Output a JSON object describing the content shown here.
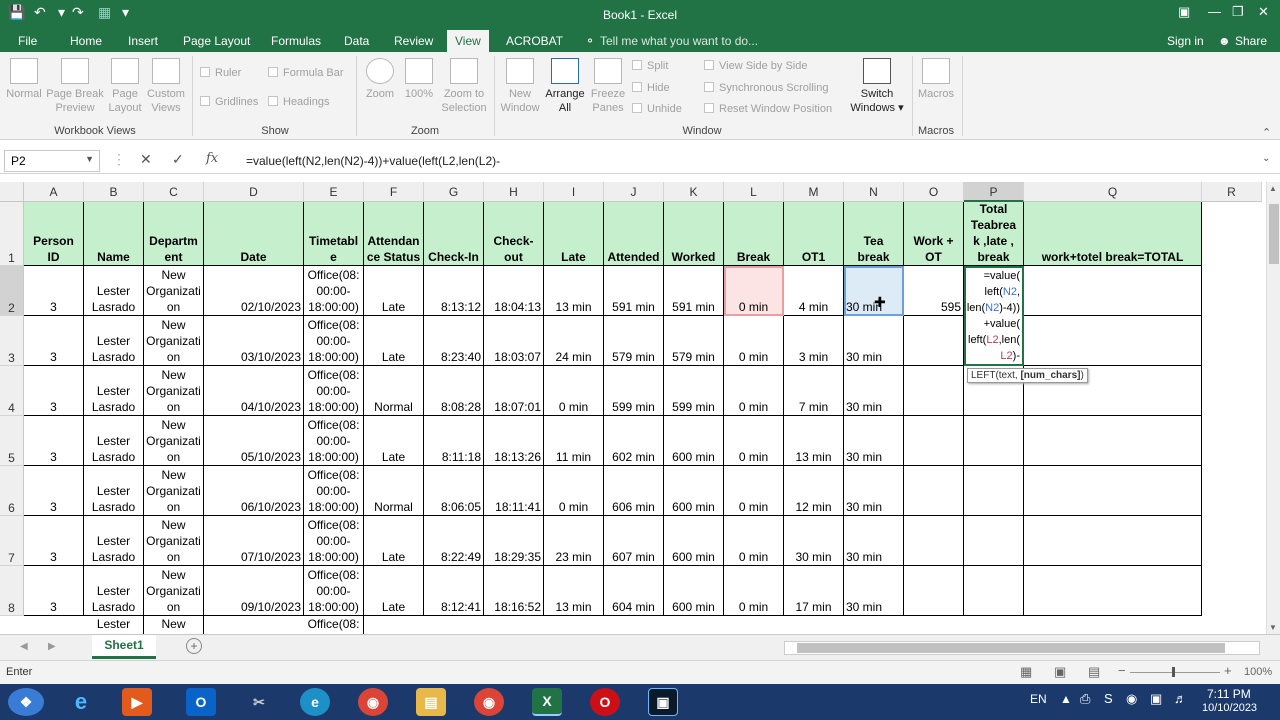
{
  "window": {
    "title": "Book1 - Excel"
  },
  "ribbon_tabs": [
    "File",
    "Home",
    "Insert",
    "Page Layout",
    "Formulas",
    "Data",
    "Review",
    "View",
    "ACROBAT"
  ],
  "active_tab": "View",
  "tell_me": "Tell me what you want to do...",
  "sign_in": "Sign in",
  "share": "Share",
  "ribbon": {
    "workbook_views": [
      "Normal",
      "Page Break Preview",
      "Page Layout",
      "Custom Views"
    ],
    "workbook_views_label": "Workbook Views",
    "show": {
      "ruler": "Ruler",
      "formula_bar": "Formula Bar",
      "gridlines": "Gridlines",
      "headings": "Headings",
      "label": "Show"
    },
    "zoom": {
      "zoom": "Zoom",
      "zoom100": "100%",
      "zoom_sel": "Zoom to Selection",
      "label": "Zoom"
    },
    "window": {
      "new_window": "New Window",
      "arrange_all": "Arrange All",
      "freeze": "Freeze Panes",
      "split": "Split",
      "hide": "Hide",
      "unhide": "Unhide",
      "side_by_side": "View Side by Side",
      "sync": "Synchronous Scrolling",
      "reset": "Reset Window Position",
      "switch": "Switch Windows",
      "label": "Window"
    },
    "macros": {
      "macros": "Macros",
      "label": "Macros"
    }
  },
  "namebox": "P2",
  "formula": "=value(left(N2,len(N2)-4))+value(left(L2,len(L2)-",
  "columns": [
    "A",
    "B",
    "C",
    "D",
    "E",
    "F",
    "G",
    "H",
    "I",
    "J",
    "K",
    "L",
    "M",
    "N",
    "O",
    "P",
    "Q",
    "R"
  ],
  "headers": {
    "A": "Person ID",
    "B": "Name",
    "C": "Department",
    "D": "Date",
    "E": "Timetable",
    "F": "Attendance Status",
    "G": "Check-In",
    "H": "Check-out",
    "I": "Late",
    "J": "Attended",
    "K": "Worked",
    "L": "Break",
    "M": "OT1",
    "N": "Tea break",
    "O": "Work + OT",
    "P": "Total Teabreak ,late , break",
    "Q": "work+totel break=TOTAL"
  },
  "header_wrapped": {
    "C": "Departm\nent",
    "E": "Timetabl\ne",
    "F": "Attendan\nce Status",
    "H": "Check-\nout",
    "P": "Total\nTeabrea\nk ,late ,\nbreak"
  },
  "rows": [
    {
      "num": "2",
      "id": "3",
      "name": "Lester Lasrado",
      "dept": "New Organizati on",
      "date": "02/10/2023",
      "timetable": "Office(08: 00:00- 18:00:00)",
      "status": "Late",
      "checkin": "8:13:12",
      "checkout": "18:04:13",
      "late": "13 min",
      "attended": "591 min",
      "worked": "591 min",
      "break": "0 min",
      "ot1": "4 min",
      "tea": "30 min",
      "workot": "595"
    },
    {
      "num": "3",
      "id": "3",
      "name": "Lester Lasrado",
      "dept": "New Organizati on",
      "date": "03/10/2023",
      "timetable": "Office(08: 00:00- 18:00:00)",
      "status": "Late",
      "checkin": "8:23:40",
      "checkout": "18:03:07",
      "late": "24 min",
      "attended": "579 min",
      "worked": "579 min",
      "break": "0 min",
      "ot1": "3 min",
      "tea": "30 min",
      "workot": ""
    },
    {
      "num": "4",
      "id": "3",
      "name": "Lester Lasrado",
      "dept": "New Organizati on",
      "date": "04/10/2023",
      "timetable": "Office(08: 00:00- 18:00:00)",
      "status": "Normal",
      "checkin": "8:08:28",
      "checkout": "18:07:01",
      "late": "0 min",
      "attended": "599 min",
      "worked": "599 min",
      "break": "0 min",
      "ot1": "7 min",
      "tea": "30 min",
      "workot": ""
    },
    {
      "num": "5",
      "id": "3",
      "name": "Lester Lasrado",
      "dept": "New Organizati on",
      "date": "05/10/2023",
      "timetable": "Office(08: 00:00- 18:00:00)",
      "status": "Late",
      "checkin": "8:11:18",
      "checkout": "18:13:26",
      "late": "11 min",
      "attended": "602 min",
      "worked": "600 min",
      "break": "0 min",
      "ot1": "13 min",
      "tea": "30 min",
      "workot": ""
    },
    {
      "num": "6",
      "id": "3",
      "name": "Lester Lasrado",
      "dept": "New Organizati on",
      "date": "06/10/2023",
      "timetable": "Office(08: 00:00- 18:00:00)",
      "status": "Normal",
      "checkin": "8:06:05",
      "checkout": "18:11:41",
      "late": "0 min",
      "attended": "606 min",
      "worked": "600 min",
      "break": "0 min",
      "ot1": "12 min",
      "tea": "30 min",
      "workot": ""
    },
    {
      "num": "7",
      "id": "3",
      "name": "Lester Lasrado",
      "dept": "New Organizati on",
      "date": "07/10/2023",
      "timetable": "Office(08: 00:00- 18:00:00)",
      "status": "Late",
      "checkin": "8:22:49",
      "checkout": "18:29:35",
      "late": "23 min",
      "attended": "607 min",
      "worked": "600 min",
      "break": "0 min",
      "ot1": "30 min",
      "tea": "30 min",
      "workot": ""
    },
    {
      "num": "8",
      "id": "3",
      "name": "Lester Lasrado",
      "dept": "New Organizati on",
      "date": "09/10/2023",
      "timetable": "Office(08: 00:00- 18:00:00)",
      "status": "Late",
      "checkin": "8:12:41",
      "checkout": "18:16:52",
      "late": "13 min",
      "attended": "604 min",
      "worked": "600 min",
      "break": "0 min",
      "ot1": "17 min",
      "tea": "30 min",
      "workot": ""
    }
  ],
  "partial_row": {
    "name": "Lester",
    "dept": "New Organizati",
    "timetable": "Office(08:"
  },
  "edit_cell": {
    "line1": "=value(",
    "line2": "left(",
    "ref1": "N2",
    "line3": "len(",
    "ref2": "N2",
    "line3b": ")-4))",
    "line4": "+value(",
    "line5": "left(",
    "ref3": "L2",
    "line5b": ",len(",
    "line6": "L2",
    "line6b": ")-"
  },
  "tooltip": {
    "fn": "LEFT(text, ",
    "arg": "[num_chars]",
    "close": ")"
  },
  "sheet_tab": "Sheet1",
  "status_mode": "Enter",
  "zoom_level": "100%",
  "taskbar": {
    "lang": "EN",
    "time": "7:11 PM",
    "date": "10/10/2023"
  },
  "colors": {
    "excel_green": "#217346",
    "header_fill": "#c6efce",
    "break_fill": "#fce4e4",
    "tea_fill": "#ddebf7"
  }
}
